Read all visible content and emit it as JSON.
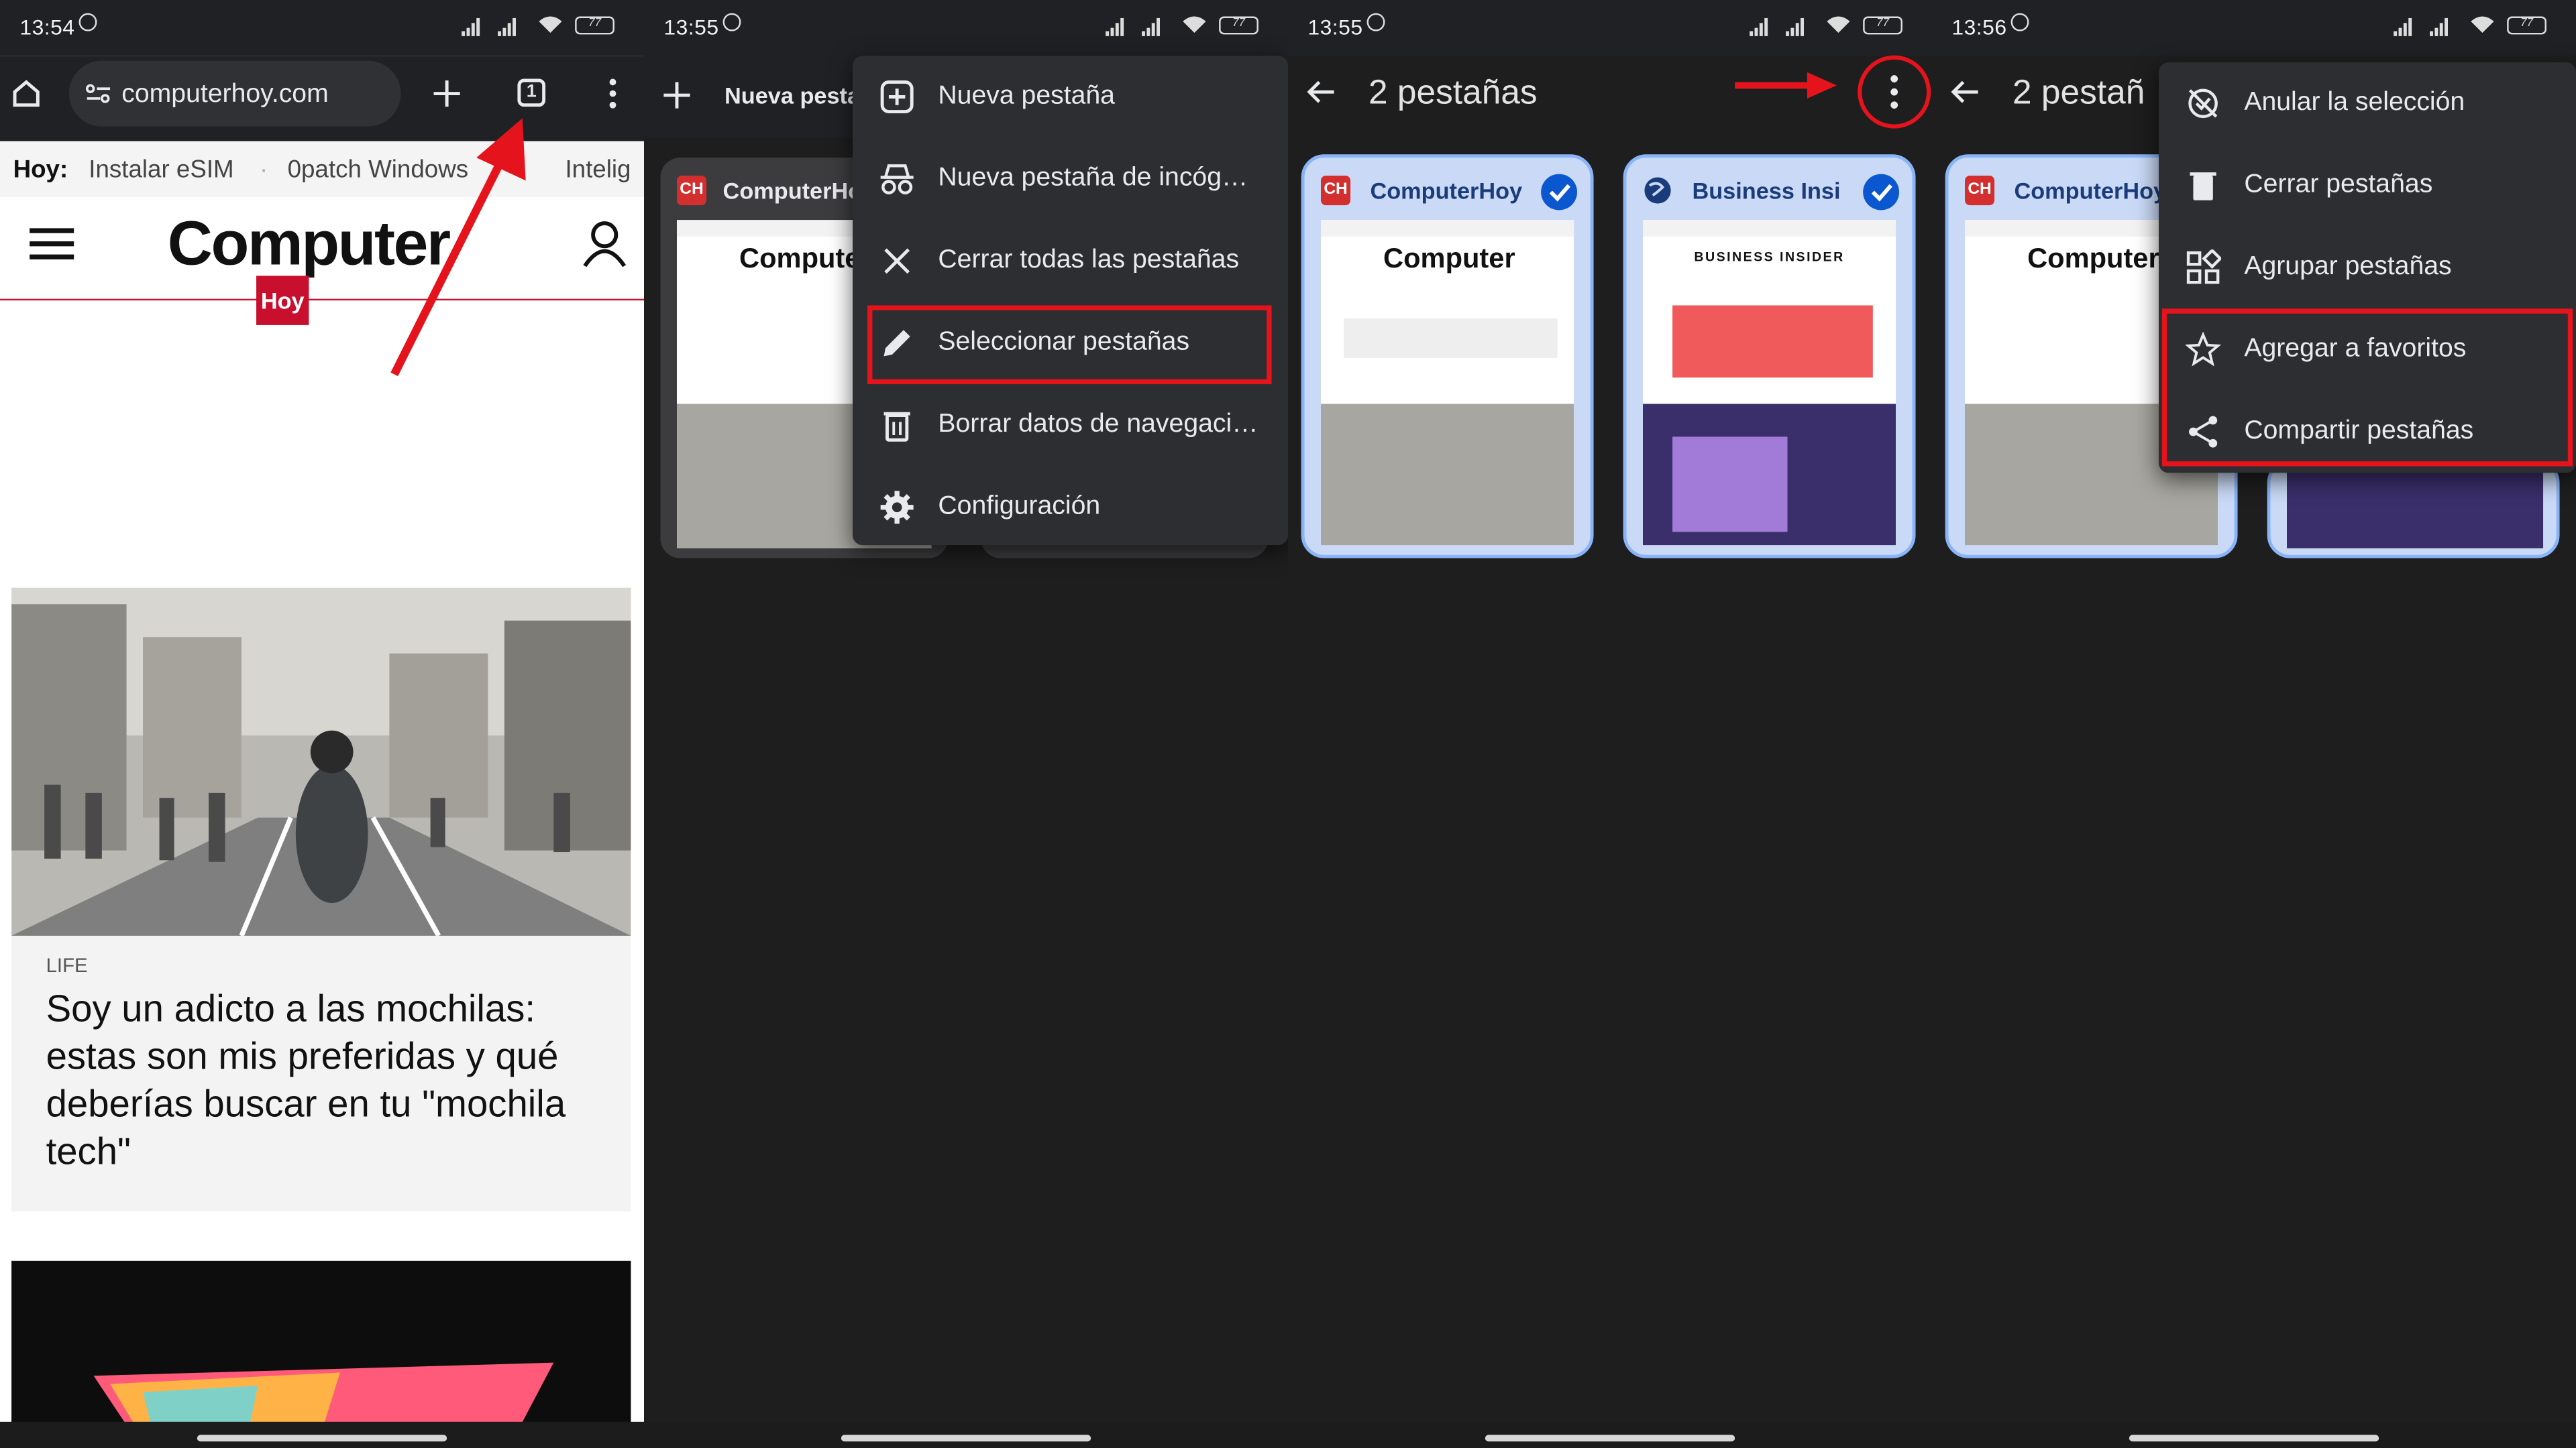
{
  "panels": [
    {
      "time": "13:54",
      "battery": "77"
    },
    {
      "time": "13:55",
      "battery": "77"
    },
    {
      "time": "13:55",
      "battery": "77"
    },
    {
      "time": "13:56",
      "battery": "77"
    }
  ],
  "browser": {
    "url": "computerhoy.com",
    "tab_count": "1",
    "trending_label": "Hoy:",
    "trending": [
      "Instalar eSIM",
      "0patch Windows",
      "Intelig"
    ]
  },
  "site": {
    "logo": "Computer",
    "logo_sub": "Hoy",
    "article": {
      "kicker": "LIFE",
      "headline": "Soy un adicto a las mochilas: estas son mis preferidas y qué deberías buscar en tu \"mochila tech\""
    }
  },
  "tab_switcher": {
    "new_tab_short": "Nueva pesta",
    "tabs": [
      {
        "title": "ComputerHoy",
        "favicon": "CH"
      },
      {
        "title": "Business Insi",
        "favicon": "globe-icon"
      }
    ]
  },
  "menu_main": {
    "items": [
      {
        "label": "Nueva pestaña",
        "icon": "plus-box-icon"
      },
      {
        "label": "Nueva pestaña de incóg…",
        "icon": "incognito-icon"
      },
      {
        "label": "Cerrar todas las pestañas",
        "icon": "close-icon"
      },
      {
        "label": "Seleccionar pestañas",
        "icon": "pencil-icon",
        "highlighted": true
      },
      {
        "label": "Borrar datos de navegaci…",
        "icon": "trash-icon"
      },
      {
        "label": "Configuración",
        "icon": "gear-icon"
      }
    ]
  },
  "selection": {
    "title": "2 pestañas",
    "title_short": "2 pestañ",
    "cards": [
      {
        "title": "ComputerHoy",
        "mini_logo": "Computer",
        "checked": true
      },
      {
        "title": "Business Insi",
        "mini_logo": "BUSINESS INSIDER",
        "checked": true
      }
    ]
  },
  "menu_selection": {
    "items": [
      {
        "label": "Anular la selección",
        "icon": "deselect-icon"
      },
      {
        "label": "Cerrar pestañas",
        "icon": "trash-icon"
      },
      {
        "label": "Agrupar pestañas",
        "icon": "group-icon"
      },
      {
        "label": "Agregar a favoritos",
        "icon": "star-icon",
        "highlighted": true
      },
      {
        "label": "Compartir pestañas",
        "icon": "share-icon",
        "highlighted": true
      }
    ]
  },
  "colors": {
    "highlight": "#e5141c",
    "accent": "#0b57d0",
    "brand": "#c8102e"
  }
}
